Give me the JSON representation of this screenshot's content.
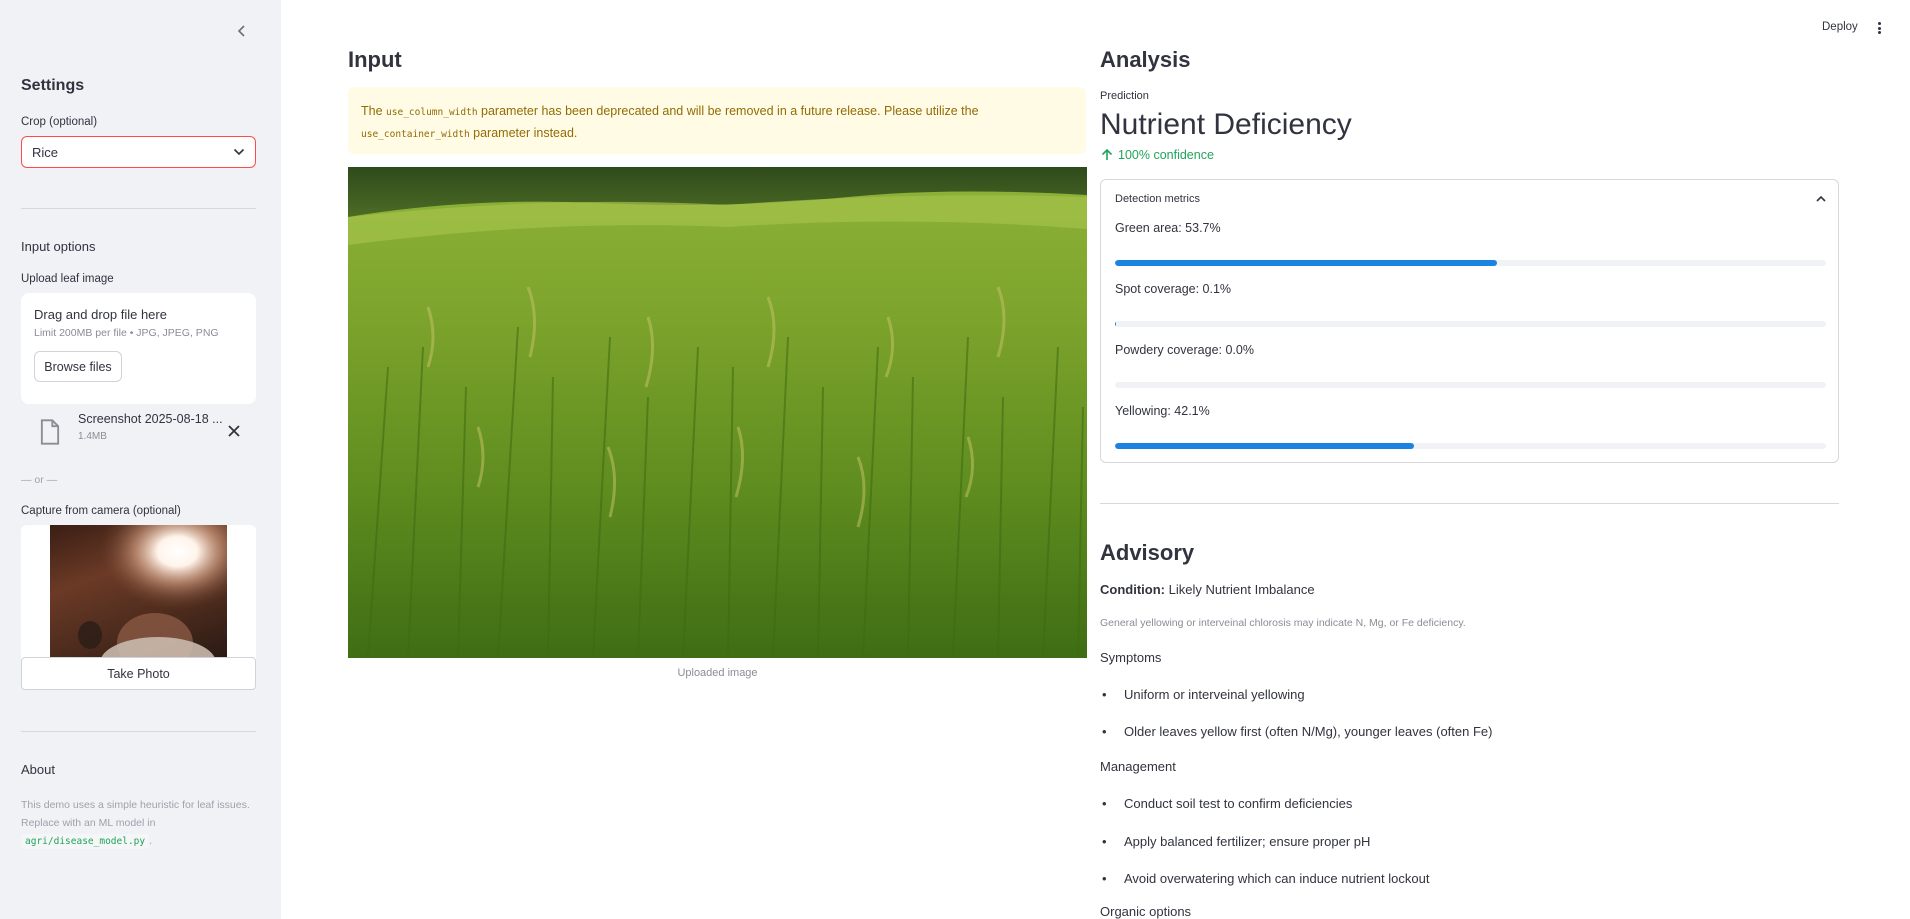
{
  "sidebar": {
    "title": "Settings",
    "crop_label": "Crop (optional)",
    "crop_value": "Rice",
    "input_options_title": "Input options",
    "upload_label": "Upload leaf image",
    "dropzone_title": "Drag and drop file here",
    "dropzone_limit": "Limit 200MB per file • JPG, JPEG, PNG",
    "browse_label": "Browse files",
    "file_name": "Screenshot 2025-08-18 ...",
    "file_size": "1.4MB",
    "or_separator": "— or —",
    "camera_label": "Capture from camera (optional)",
    "take_photo_label": "Take Photo",
    "about_title": "About",
    "about_text_1": "This demo uses a simple heuristic for leaf issues. Replace with an ML model in",
    "about_code": "agri/disease_model.py",
    "about_text_2": "."
  },
  "header": {
    "deploy_label": "Deploy"
  },
  "input": {
    "title": "Input",
    "warning_pre": "The",
    "warning_code1": "use_column_width",
    "warning_mid": "parameter has been deprecated and will be removed in a future release. Please utilize the",
    "warning_code2": "use_container_width",
    "warning_post": "parameter instead.",
    "image_caption": "Uploaded image"
  },
  "analysis": {
    "title": "Analysis",
    "prediction_label": "Prediction",
    "prediction_value": "Nutrient Deficiency",
    "confidence": "100% confidence",
    "metrics_title": "Detection metrics",
    "metrics": [
      {
        "label": "Green area: 53.7%",
        "value": 53.7
      },
      {
        "label": "Spot coverage: 0.1%",
        "value": 0.1
      },
      {
        "label": "Powdery coverage: 0.0%",
        "value": 0.0
      },
      {
        "label": "Yellowing: 42.1%",
        "value": 42.1
      }
    ]
  },
  "advisory": {
    "title": "Advisory",
    "condition_label": "Condition:",
    "condition_value": "Likely Nutrient Imbalance",
    "note": "General yellowing or interveinal chlorosis may indicate N, Mg, or Fe deficiency.",
    "symptoms_title": "Symptoms",
    "symptoms": [
      "Uniform or interveinal yellowing",
      "Older leaves yellow first (often N/Mg), younger leaves (often Fe)"
    ],
    "management_title": "Management",
    "management": [
      "Conduct soil test to confirm deficiencies",
      "Apply balanced fertilizer; ensure proper pH",
      "Avoid overwatering which can induce nutrient lockout"
    ],
    "organic_title": "Organic options"
  },
  "colors": {
    "accent_red": "#ff4b4b",
    "progress_blue": "#1c83e1",
    "success_green": "#21a35b",
    "warning_bg": "#fffbe5",
    "warning_text": "#926c05"
  }
}
